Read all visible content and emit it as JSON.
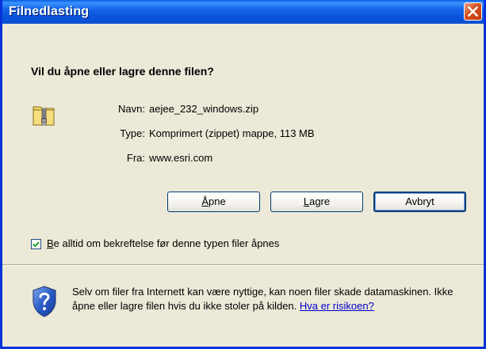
{
  "window": {
    "title": "Filnedlasting"
  },
  "question": "Vil du åpne eller lagre denne filen?",
  "file": {
    "name_label": "Navn:",
    "name_value": "aejee_232_windows.zip",
    "type_label": "Type:",
    "type_value": "Komprimert (zippet) mappe, 113 MB",
    "from_label": "Fra:",
    "from_value": "www.esri.com"
  },
  "buttons": {
    "open": {
      "accel": "Å",
      "rest": "pne"
    },
    "save": {
      "accel": "L",
      "rest": "agre"
    },
    "cancel": {
      "label": "Avbryt"
    }
  },
  "checkbox": {
    "checked": true,
    "accel": "B",
    "rest": "e alltid om bekreftelse før denne typen filer åpnes"
  },
  "warning": {
    "text": "Selv om filer fra Internett kan være nyttige, kan noen filer skade datamaskinen. Ikke åpne eller lagre filen hvis du ikke stoler på kilden.",
    "link": "Hva er risikoen?"
  },
  "colors": {
    "title_bar": "#0A55DB",
    "dialog_bg": "#ECE9D8",
    "close_button": "#D5501F",
    "link": "#0000CC"
  },
  "icons": [
    "close-icon",
    "zip-folder-icon",
    "checkmark-icon",
    "shield-question-icon"
  ]
}
